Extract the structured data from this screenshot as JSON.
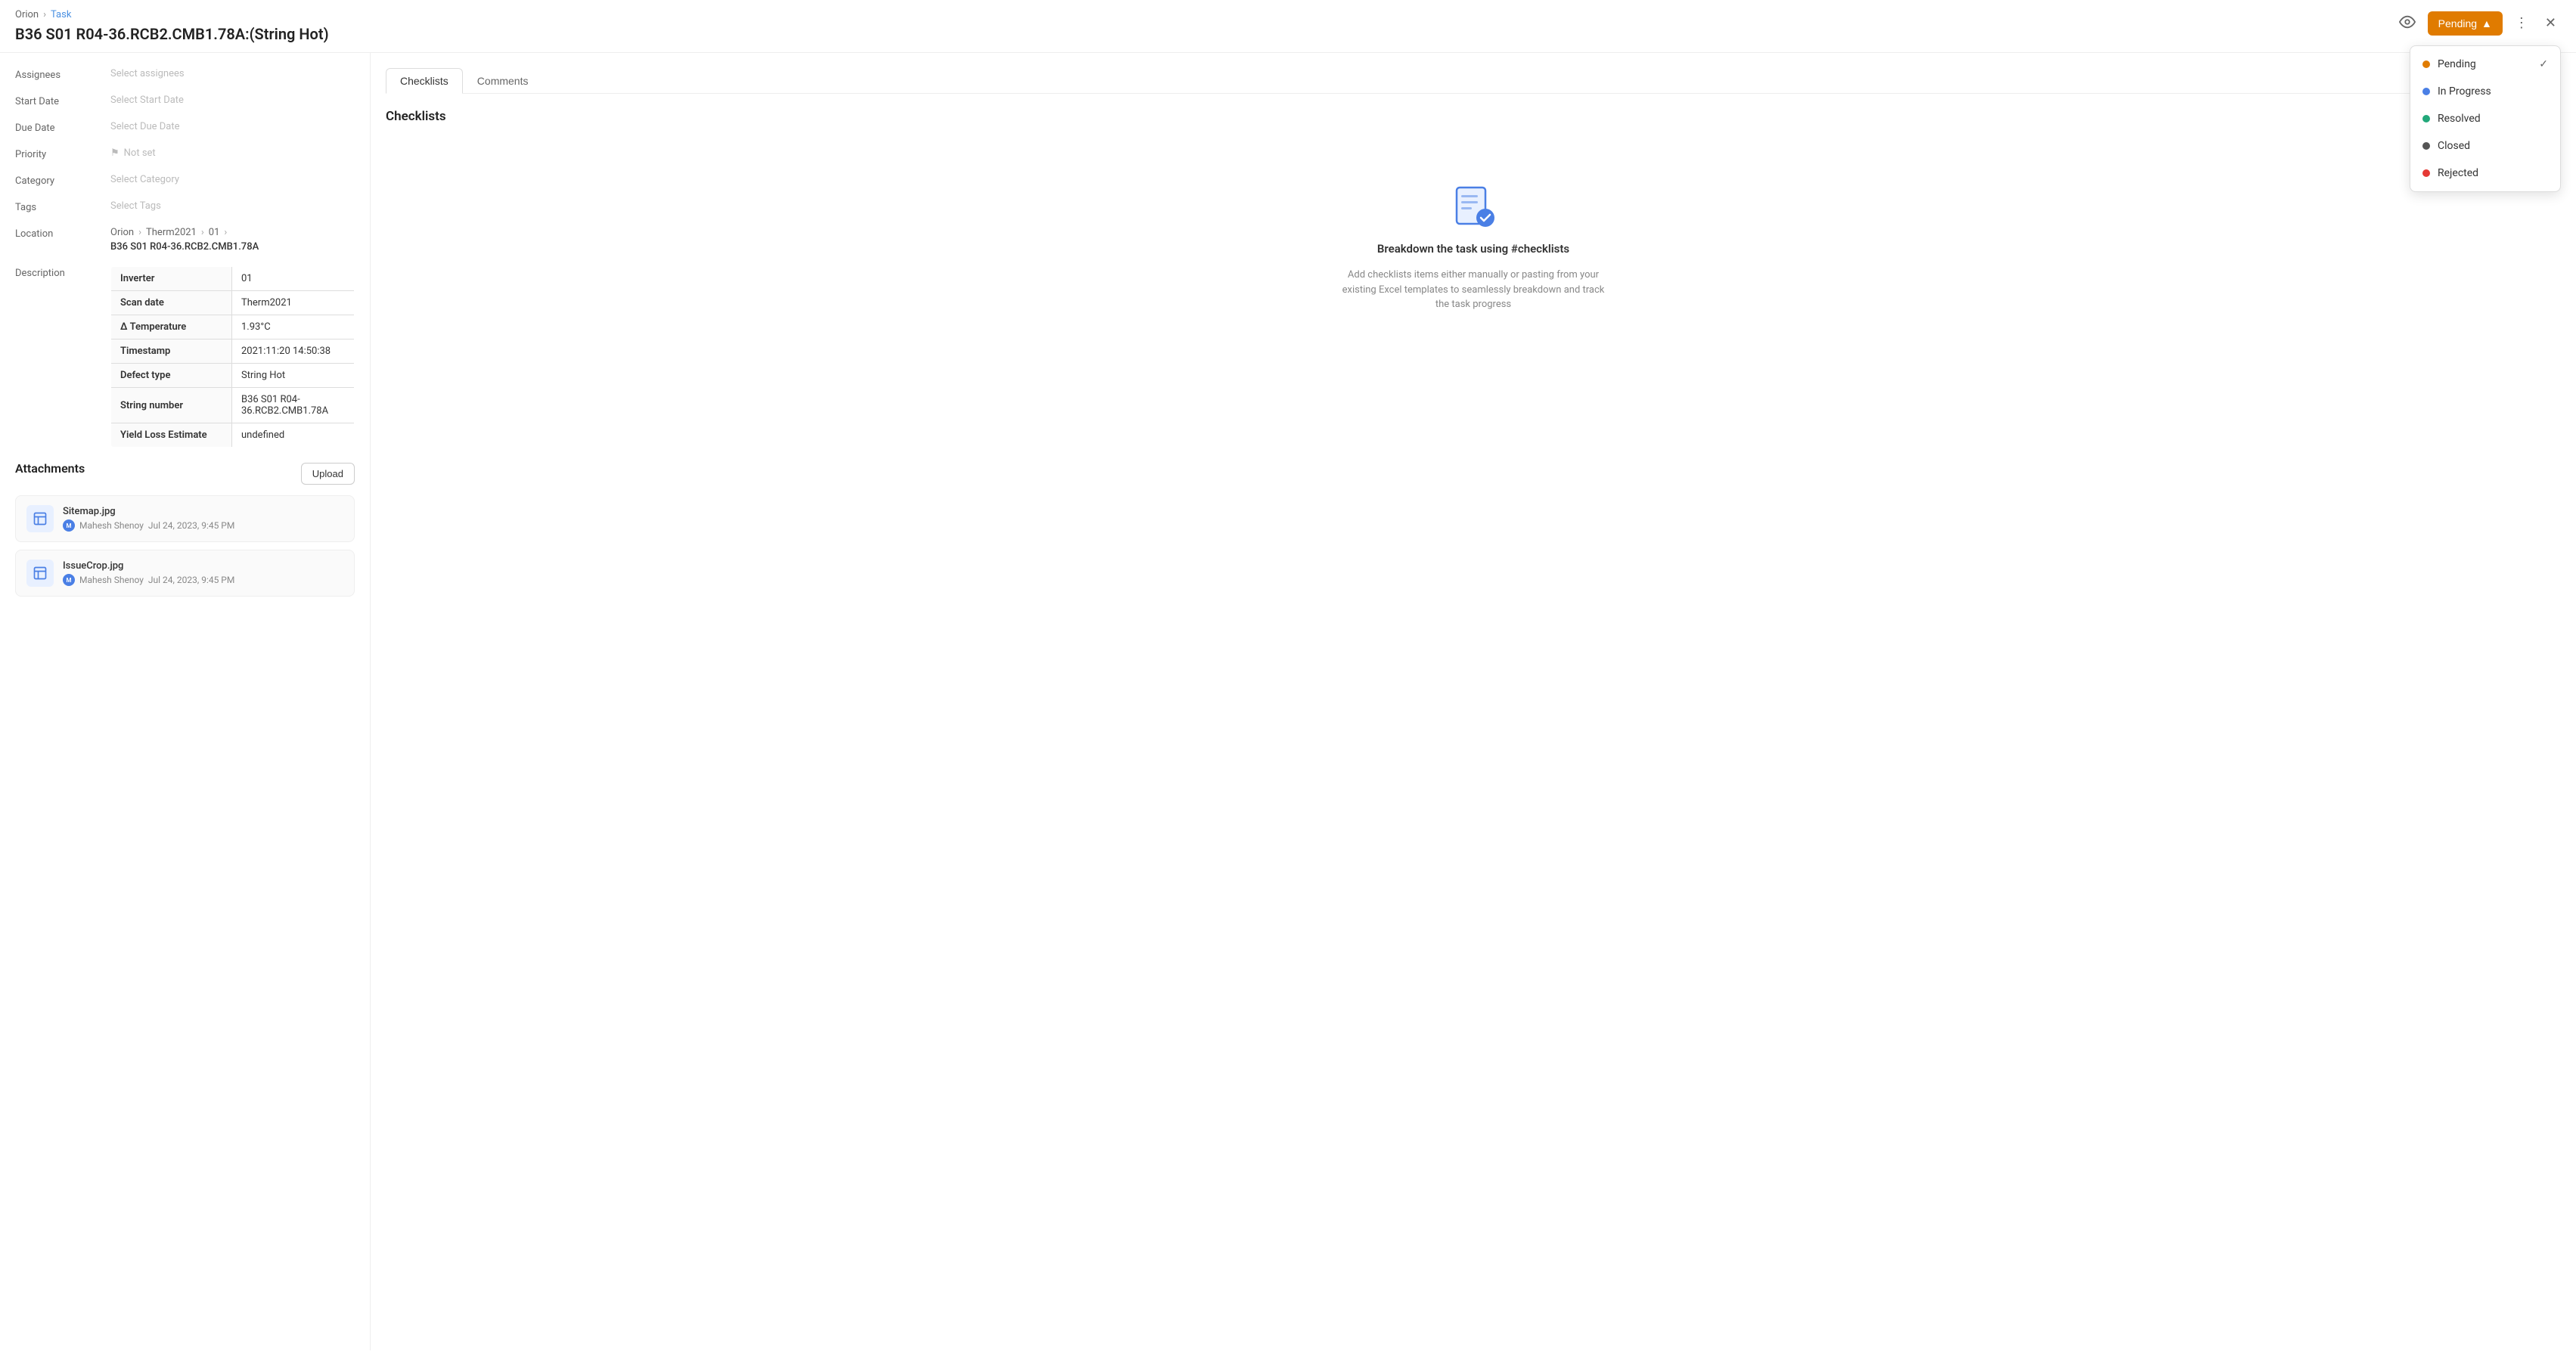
{
  "breadcrumb": {
    "parent": "Orion",
    "separator": ">",
    "current": "Task"
  },
  "page": {
    "title": "B36 S01 R04-36.RCB2.CMB1.78A:(String Hot)"
  },
  "header_actions": {
    "status_label": "Pending",
    "chevron": "▲"
  },
  "fields": {
    "assignees_label": "Assignees",
    "assignees_placeholder": "Select assignees",
    "start_date_label": "Start Date",
    "start_date_placeholder": "Select Start Date",
    "due_date_label": "Due Date",
    "due_date_placeholder": "Select Due Date",
    "priority_label": "Priority",
    "priority_value": "Not set",
    "category_label": "Category",
    "category_placeholder": "Select Category",
    "tags_label": "Tags",
    "tags_placeholder": "Select Tags",
    "location_label": "Location",
    "location_path": [
      "Orion",
      "Therm2021",
      "01"
    ],
    "location_name": "B36 S01 R04-36.RCB2.CMB1.78A",
    "description_label": "Description"
  },
  "description_table": [
    {
      "key": "Inverter",
      "value": "01"
    },
    {
      "key": "Scan date",
      "value": "Therm2021"
    },
    {
      "key": "Δ Temperature",
      "value": "1.93°C"
    },
    {
      "key": "Timestamp",
      "value": "2021:11:20 14:50:38"
    },
    {
      "key": "Defect type",
      "value": "String Hot"
    },
    {
      "key": "String number",
      "value": "B36 S01 R04-36.RCB2.CMB1.78A"
    },
    {
      "key": "Yield Loss Estimate",
      "value": "undefined"
    }
  ],
  "attachments": {
    "title": "Attachments",
    "upload_label": "Upload",
    "items": [
      {
        "name": "Sitemap.jpg",
        "uploader": "Mahesh Shenoy",
        "uploader_initial": "M",
        "date": "Jul 24, 2023, 9:45 PM"
      },
      {
        "name": "IssueCrop.jpg",
        "uploader": "Mahesh Shenoy",
        "uploader_initial": "M",
        "date": "Jul 24, 2023, 9:45 PM"
      }
    ]
  },
  "tabs": [
    {
      "id": "checklists",
      "label": "Checklists",
      "active": true
    },
    {
      "id": "comments",
      "label": "Comments",
      "active": false
    }
  ],
  "checklists": {
    "title": "Checklists",
    "empty_title": "Breakdown the task using #checklists",
    "empty_desc": "Add checklists items either manually or pasting from your existing Excel templates to seamlessly breakdown and track the task progress"
  },
  "status_dropdown": {
    "items": [
      {
        "id": "pending",
        "label": "Pending",
        "dot": "orange",
        "selected": true
      },
      {
        "id": "in-progress",
        "label": "In Progress",
        "dot": "blue",
        "selected": false
      },
      {
        "id": "resolved",
        "label": "Resolved",
        "dot": "green",
        "selected": false
      },
      {
        "id": "closed",
        "label": "Closed",
        "dot": "gray",
        "selected": false
      },
      {
        "id": "rejected",
        "label": "Rejected",
        "dot": "red",
        "selected": false
      }
    ]
  }
}
